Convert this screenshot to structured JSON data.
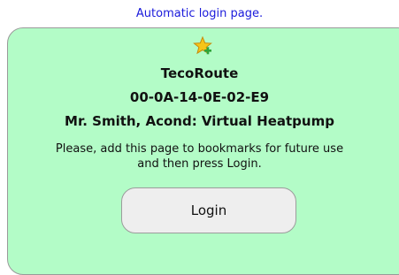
{
  "header": {
    "link_text": "Automatic login page."
  },
  "panel": {
    "icon": "star-add-icon",
    "app_name": "TecoRoute",
    "device_id": "00-0A-14-0E-02-E9",
    "device_name": "Mr. Smith, Acond: Virtual Heatpump",
    "description_line1": "Please, add this page to bookmarks for future use",
    "description_line2": "and then press Login.",
    "login_label": "Login"
  },
  "colors": {
    "panel_background": "#b3fcc7",
    "link": "#1a1adb",
    "button_background": "#eeeeee"
  }
}
